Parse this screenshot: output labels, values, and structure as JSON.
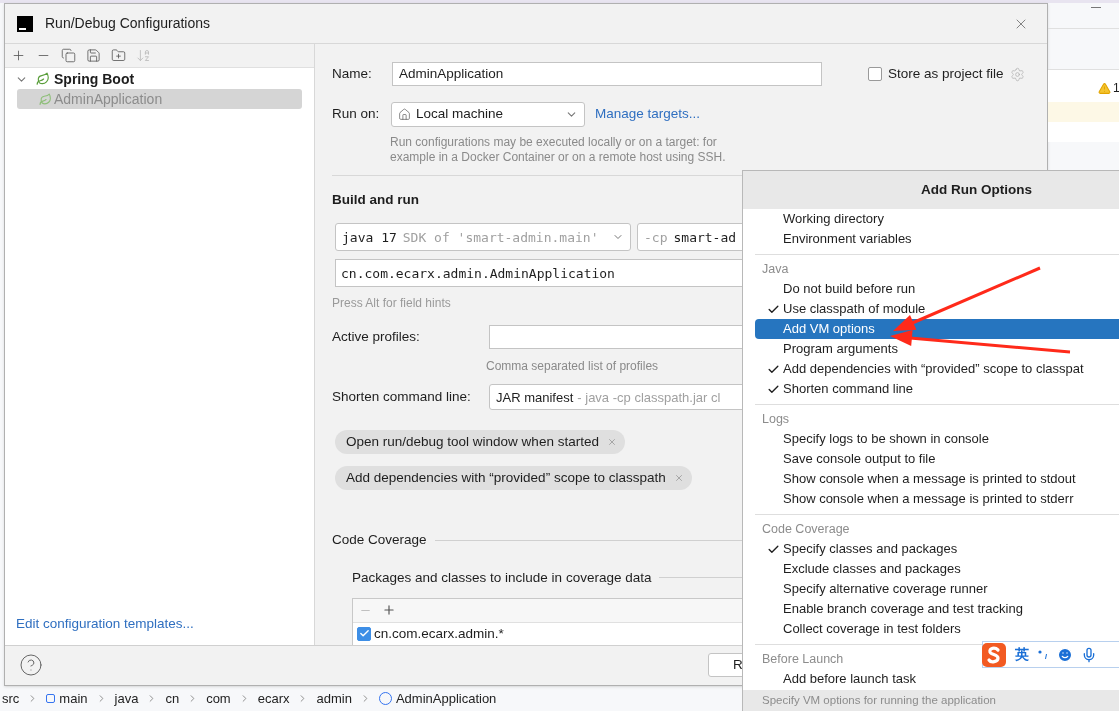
{
  "background": {
    "warning_count": "1",
    "breadcrumb": [
      {
        "label": "src",
        "kind": "folder"
      },
      {
        "label": "main",
        "kind": "module"
      },
      {
        "label": "java",
        "kind": "folder"
      },
      {
        "label": "cn",
        "kind": "folder"
      },
      {
        "label": "com",
        "kind": "folder"
      },
      {
        "label": "ecarx",
        "kind": "folder"
      },
      {
        "label": "admin",
        "kind": "folder"
      },
      {
        "label": "AdminApplication",
        "kind": "class"
      }
    ]
  },
  "dialog": {
    "title": "Run/Debug Configurations",
    "toolbar": [
      {
        "kind": "add",
        "disabled": false
      },
      {
        "kind": "remove",
        "disabled": false
      },
      {
        "kind": "copy",
        "disabled": false
      },
      {
        "kind": "save",
        "disabled": false
      },
      {
        "kind": "folder",
        "disabled": false
      },
      {
        "kind": "sort",
        "disabled": true
      }
    ],
    "tree": [
      {
        "label": "Spring Boot",
        "expanded": true,
        "children": [
          {
            "label": "AdminApplication",
            "selected": true
          }
        ]
      }
    ],
    "templates_link": "Edit configuration templates...",
    "name": {
      "label": "Name:",
      "value": "AdminApplication"
    },
    "store_as_project_file": {
      "label": "Store as project file",
      "checked": false
    },
    "run_on": {
      "label": "Run on:",
      "value": "Local machine",
      "link": "Manage targets...",
      "hint": "Run configurations may be executed locally or on a target: for example in a Docker Container or on a remote host using SSH."
    },
    "build_and_run": {
      "title": "Build and run",
      "jdk": {
        "value": "java 17",
        "hint": "SDK of 'smart-admin.main'"
      },
      "classpath": {
        "prefix": "-cp",
        "value": "smart-ad"
      },
      "main_class": "cn.com.ecarx.admin.AdminApplication",
      "hint": "Press Alt for field hints"
    },
    "active_profiles": {
      "label": "Active profiles:",
      "hint": "Comma separated list of profiles"
    },
    "shorten": {
      "label": "Shorten command line:",
      "value": "JAR manifest",
      "hint": "- java -cp classpath.jar cl"
    },
    "chips": [
      "Open run/debug tool window when started",
      "Add dependencies with “provided” scope to classpath"
    ],
    "code_coverage": {
      "title": "Code Coverage",
      "packages_title": "Packages and classes to include in coverage data",
      "entries": [
        {
          "pattern": "cn.com.ecarx.admin.*",
          "checked": true
        }
      ]
    },
    "footer": {
      "button": "R"
    }
  },
  "popup": {
    "title": "Add Run Options",
    "hint": "Specify VM options for running the application",
    "groups": [
      {
        "items": [
          {
            "label": "Working directory",
            "checked": false,
            "selected": false
          },
          {
            "label": "Environment variables",
            "checked": false,
            "selected": false
          }
        ]
      },
      {
        "header": "Java",
        "items": [
          {
            "label": "Do not build before run",
            "checked": false,
            "selected": false
          },
          {
            "label": "Use classpath of module",
            "checked": true,
            "selected": false
          },
          {
            "label": "Add VM options",
            "checked": false,
            "selected": true
          },
          {
            "label": "Program arguments",
            "checked": false,
            "selected": false
          },
          {
            "label": "Add dependencies with “provided” scope to classpat",
            "checked": true,
            "selected": false
          },
          {
            "label": "Shorten command line",
            "checked": true,
            "selected": false
          }
        ]
      },
      {
        "header": "Logs",
        "items": [
          {
            "label": "Specify logs to be shown in console",
            "checked": false,
            "selected": false
          },
          {
            "label": "Save console output to file",
            "checked": false,
            "selected": false
          },
          {
            "label": "Show console when a message is printed to stdout",
            "checked": false,
            "selected": false
          },
          {
            "label": "Show console when a message is printed to stderr",
            "checked": false,
            "selected": false
          }
        ]
      },
      {
        "header": "Code Coverage",
        "items": [
          {
            "label": "Specify classes and packages",
            "checked": true,
            "selected": false
          },
          {
            "label": "Exclude classes and packages",
            "checked": false,
            "selected": false
          },
          {
            "label": "Specify alternative coverage runner",
            "checked": false,
            "selected": false
          },
          {
            "label": "Enable branch coverage and test tracking",
            "checked": false,
            "selected": false
          },
          {
            "label": "Collect coverage in test folders",
            "checked": false,
            "selected": false
          }
        ]
      },
      {
        "header": "Before Launch",
        "items": [
          {
            "label": "Add before launch task",
            "checked": false,
            "selected": false
          }
        ]
      }
    ]
  },
  "ime": {
    "mode": "英"
  }
}
